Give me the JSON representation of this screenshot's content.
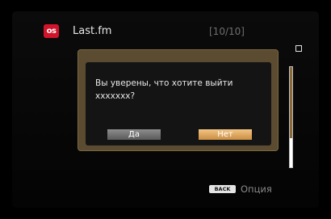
{
  "header": {
    "logo_text": "os",
    "source_name": "Last.fm",
    "page_counter": "[10/10]",
    "options_icon": "square-icon"
  },
  "dialog": {
    "message": "Вы уверены, что хотите выйти\nxxxxxxx?",
    "yes_label": "Да",
    "no_label": "Нет"
  },
  "footer": {
    "back_key": "BACK",
    "option_label": "Опция"
  },
  "colors": {
    "lastfm_red": "#d0142b",
    "dialog_frame": "#5a4b31",
    "selected_button": "#e0a85f",
    "unselected_button": "#7a7a7a"
  }
}
